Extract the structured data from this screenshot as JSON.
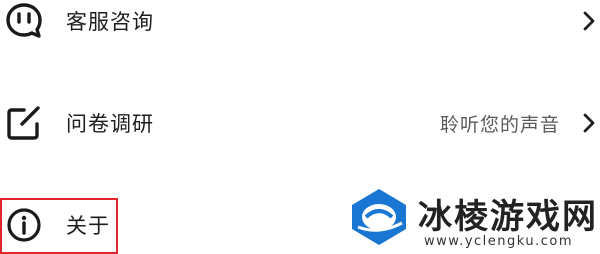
{
  "menu": {
    "items": [
      {
        "label": "客服咨询",
        "hint": "",
        "icon": "chat-bubble-icon",
        "chevron": "chevron-right-icon"
      },
      {
        "label": "问卷调研",
        "hint": "聆听您的声音",
        "icon": "edit-note-icon",
        "chevron": "chevron-right-icon"
      },
      {
        "label": "关于",
        "hint": "",
        "icon": "info-icon"
      }
    ]
  },
  "watermark": {
    "name": "冰棱游戏网",
    "url": "www.yclengku.com"
  },
  "colors": {
    "highlight": "#e0262a",
    "watermark_blue": "#1976d2",
    "text": "#1e1e1e",
    "hint_text": "#5a5a5a"
  }
}
